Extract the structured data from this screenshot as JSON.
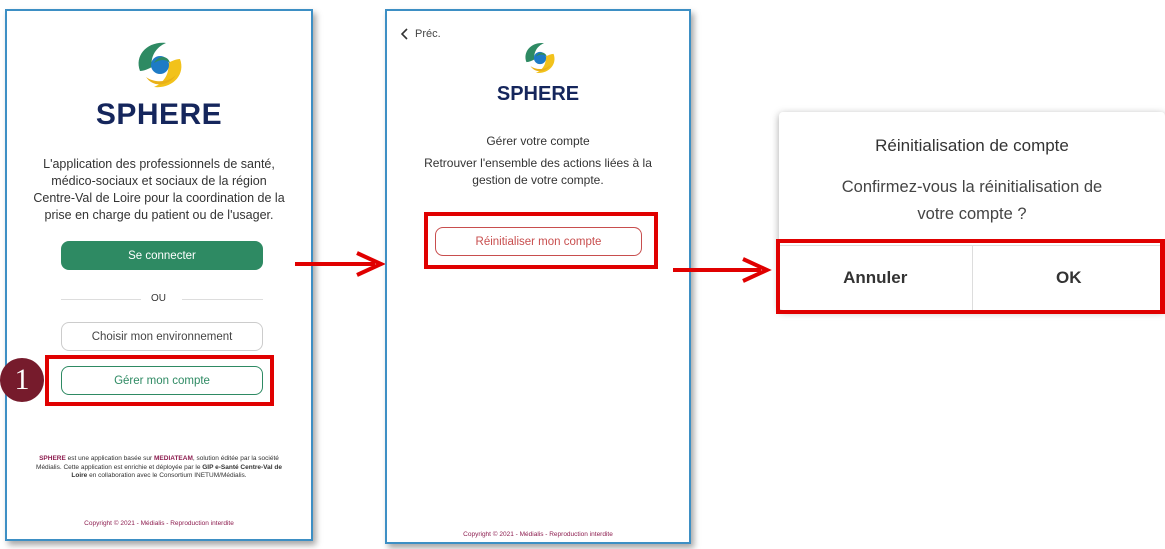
{
  "screen1": {
    "brand": "SPHERE",
    "description": "L'application des professionnels de santé, médico-sociaux et sociaux de la région Centre-Val de Loire pour la coordination de la prise en charge du patient ou de l'usager.",
    "connect_button": "Se connecter",
    "or_label": "OU",
    "env_button": "Choisir mon environnement",
    "account_button": "Gérer mon compte",
    "footer_p1": "SPHERE",
    "footer_p2": " est une application basée sur ",
    "footer_p3": "MEDIATEAM",
    "footer_p4": ", solution éditée par la société Médialis. Cette application est enrichie et déployée par le ",
    "footer_p5": "GIP e-Santé Centre-Val de Loire",
    "footer_p6": " en collaboration avec le Consortium INETUM/Médialis.",
    "copyright": "Copyright © 2021 - Médialis - Reproduction interdite"
  },
  "step_badge": "1",
  "screen2": {
    "back_label": "Préc.",
    "brand": "SPHERE",
    "title": "Gérer votre compte",
    "description": "Retrouver l'ensemble des actions liées à la gestion de votre compte.",
    "reset_button": "Réinitialiser mon compte",
    "copyright": "Copyright © 2021 - Médialis - Reproduction interdite"
  },
  "dialog": {
    "title": "Réinitialisation de compte",
    "message_line1": "Confirmez-vous la réinitialisation de",
    "message_line2": "votre compte ?",
    "cancel_button": "Annuler",
    "ok_button": "OK"
  },
  "colors": {
    "brand_navy": "#15265c",
    "primary_green": "#2e8a63",
    "accent_red": "#e00000",
    "badge_maroon": "#761b2c",
    "link_maroon": "#8d1d4f",
    "frame_blue": "#3d8fc4"
  },
  "icons": {
    "logo": "sphere-logo-icon",
    "back": "chevron-left-icon",
    "arrow": "arrow-right-icon"
  }
}
